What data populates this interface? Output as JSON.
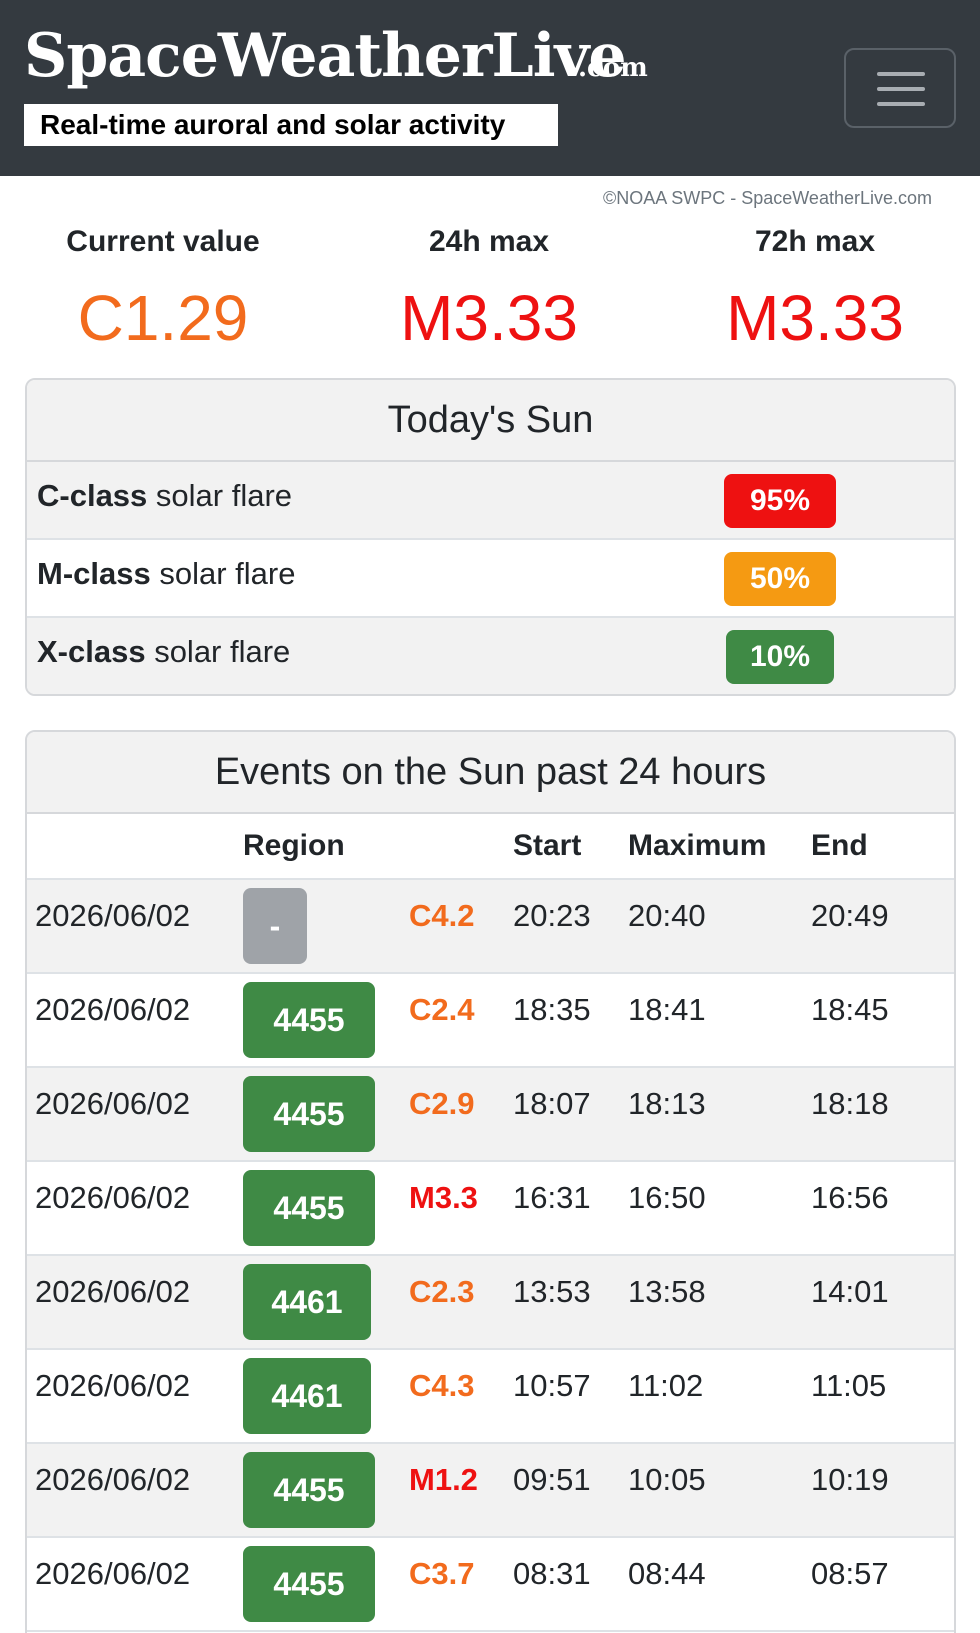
{
  "header": {
    "logo": "SpaceWeatherLive",
    "logo_suffix": ".com",
    "tagline": "Real-time auroral and solar activity",
    "menu_icon": "hamburger-menu-icon"
  },
  "credit": "©NOAA SWPC - SpaceWeatherLive.com",
  "stats": [
    {
      "label": "Current value",
      "value": "C1.29",
      "color": "#f26b1d"
    },
    {
      "label": "24h max",
      "value": "M3.33",
      "color": "#ee1111"
    },
    {
      "label": "72h max",
      "value": "M3.33",
      "color": "#ee1111"
    }
  ],
  "todays_sun": {
    "title": "Today's Sun",
    "rows": [
      {
        "class": "C-class",
        "suffix": " solar flare",
        "probability": "95%",
        "color": "#ee1111"
      },
      {
        "class": "M-class",
        "suffix": " solar flare",
        "probability": "50%",
        "color": "#f59a12"
      },
      {
        "class": "X-class",
        "suffix": " solar flare",
        "probability": "10%",
        "color": "#3f8a45"
      }
    ]
  },
  "events": {
    "title": "Events on the Sun past 24 hours",
    "headers": {
      "region": "Region",
      "start": "Start",
      "maximum": "Maximum",
      "end": "End"
    },
    "rows": [
      {
        "date": "2026/06/02",
        "region": "-",
        "class": "C4.2",
        "start": "20:23",
        "maximum": "20:40",
        "end": "20:49"
      },
      {
        "date": "2026/06/02",
        "region": "4455",
        "class": "C2.4",
        "start": "18:35",
        "maximum": "18:41",
        "end": "18:45"
      },
      {
        "date": "2026/06/02",
        "region": "4455",
        "class": "C2.9",
        "start": "18:07",
        "maximum": "18:13",
        "end": "18:18"
      },
      {
        "date": "2026/06/02",
        "region": "4455",
        "class": "M3.3",
        "start": "16:31",
        "maximum": "16:50",
        "end": "16:56"
      },
      {
        "date": "2026/06/02",
        "region": "4461",
        "class": "C2.3",
        "start": "13:53",
        "maximum": "13:58",
        "end": "14:01"
      },
      {
        "date": "2026/06/02",
        "region": "4461",
        "class": "C4.3",
        "start": "10:57",
        "maximum": "11:02",
        "end": "11:05"
      },
      {
        "date": "2026/06/02",
        "region": "4455",
        "class": "M1.2",
        "start": "09:51",
        "maximum": "10:05",
        "end": "10:19"
      },
      {
        "date": "2026/06/02",
        "region": "4455",
        "class": "C3.7",
        "start": "08:31",
        "maximum": "08:44",
        "end": "08:57"
      }
    ]
  },
  "colors": {
    "header_bg": "#343a40",
    "c_class": "#f26b1d",
    "m_class": "#ee1111",
    "region_green": "#3f8a45",
    "region_gray": "#9fa3a8"
  }
}
